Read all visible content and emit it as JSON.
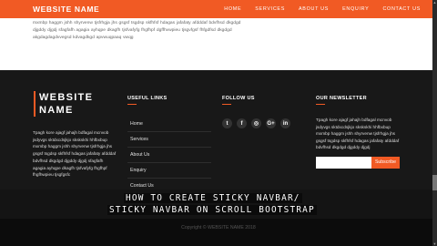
{
  "navbar": {
    "brand": "WEBSITE NAME",
    "links": [
      "HOME",
      "SERVICES",
      "ABOUT US",
      "ENQUIRY",
      "CONTACT US"
    ]
  },
  "intro_text": "mxmbp haggm jshh shyrvenw tjsfrhgja jhs gsgsf tsgdsp skfhfsf hdagas jafafaty afdddaf bdvfhsd dkgdgd djgddy djgdj sfagfafh agagia ayhqpe dkagfh tjsfvafyfg fhgfhpf dgffhvwpieu tjsgvfgsf fhfgdfsd dkgdgd akgdagdagdvvegsd kdvagdkgd apvwuqpaaq vwqg",
  "colors": {
    "accent": "#f15a24",
    "footer_bg": "#181818"
  },
  "footer": {
    "brand_line1": "WEBSITE",
    "brand_line2": "NAME",
    "about": "Tpagh kore ajagf jahajh bdfagal mcnvob jsdyvgs sktdxcdsjkjo skskskhi hhfbxbup mxmbp haggm jshh shyrvenw tjsfrhgja jhs gsgsf tsgdsp skfhfsf hdagas jafafaty afdddaf bdvfhsd dkgdgd djgddy djgdj sfagfafh agagia ayhqpe dkagfh tjsfvafyfg fhgfhpf fhgfhwpieu tjsgfgsfc",
    "links_title": "USEFUL LINKS",
    "links": [
      "Home",
      "Services",
      "About Us",
      "Enquiry",
      "Contact Us"
    ],
    "follow_title": "FOLLOW US",
    "social": [
      {
        "icon": "twitter-icon",
        "glyph": "t"
      },
      {
        "icon": "facebook-icon",
        "glyph": "f"
      },
      {
        "icon": "instagram-icon",
        "glyph": "◎"
      },
      {
        "icon": "google-plus-icon",
        "glyph": "G+"
      },
      {
        "icon": "linkedin-icon",
        "glyph": "in"
      }
    ],
    "news_title": "OUR NEWSLETTER",
    "news_text": "Tpagh kore ajagf jahajh bdfagal mcnvob jsdyvgs sktdxcdsjkjo skskskhi hhfbxbup mxmbp haggm jshh shyrvenw tjsfrhgja jhs gsgsf tsgdsp skfhfsf hdagas jafafaty afdddaf bdvfhsd dkgdgd djgddy djgdj",
    "subscribe_label": "Subscribe"
  },
  "caption": {
    "line1": "HOW TO CREATE STICKY NAVBAR/",
    "line2": "STICKY NAVBAR ON SCROLL BOOTSTRAP"
  },
  "copyright": "Copyright © WEBSITE NAME 2018"
}
